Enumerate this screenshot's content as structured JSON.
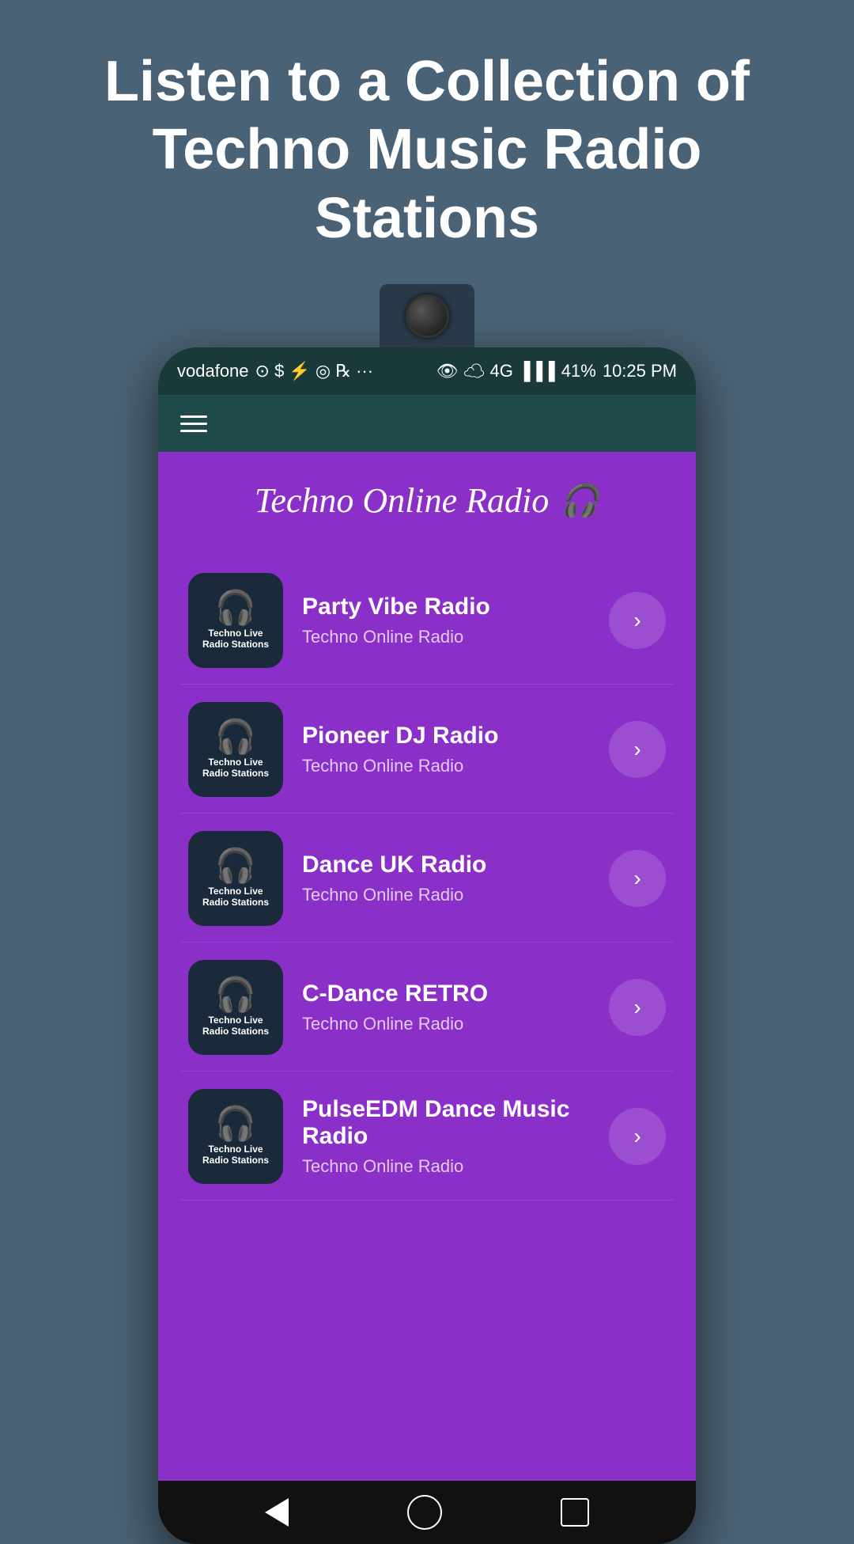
{
  "page": {
    "background_color": "#4a6275",
    "header_title": "Listen to a Collection of Techno Music Radio Stations"
  },
  "status_bar": {
    "carrier": "vodafone",
    "battery": "41%",
    "time": "10:25 PM",
    "signal": "4G"
  },
  "app": {
    "title": "Techno Online Radio",
    "toolbar_icon": "≡",
    "stations": [
      {
        "id": 1,
        "name": "Party Vibe Radio",
        "subtitle": "Techno Online Radio",
        "logo_line1": "Techno Live",
        "logo_line2": "Radio Stations"
      },
      {
        "id": 2,
        "name": "Pioneer DJ Radio",
        "subtitle": "Techno Online Radio",
        "logo_line1": "Techno Live",
        "logo_line2": "Radio Stations"
      },
      {
        "id": 3,
        "name": "Dance UK Radio",
        "subtitle": "Techno Online Radio",
        "logo_line1": "Techno Live",
        "logo_line2": "Radio Stations"
      },
      {
        "id": 4,
        "name": "C-Dance RETRO",
        "subtitle": "Techno Online Radio",
        "logo_line1": "Techno Live",
        "logo_line2": "Radio Stations"
      },
      {
        "id": 5,
        "name": "PulseEDM Dance Music Radio",
        "subtitle": "Techno Online Radio",
        "logo_line1": "Techno Live",
        "logo_line2": "Radio Stations"
      }
    ]
  }
}
